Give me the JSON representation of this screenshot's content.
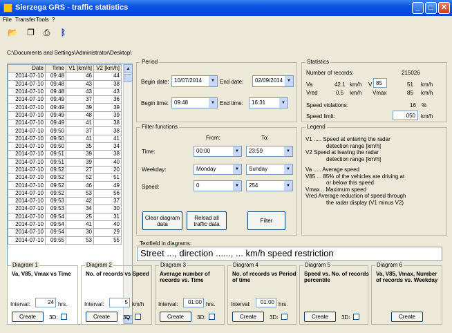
{
  "window": {
    "title": "Sierzega GRS - traffic statistics"
  },
  "menu": [
    "File",
    "Transfer",
    "Tools",
    "?"
  ],
  "path": "C:\\Documents and Settings\\Administrator\\Desktop\\",
  "table": {
    "headers": [
      "Date",
      "Time",
      "V1 [km/h]",
      "V2 [km/h]"
    ],
    "rows": [
      [
        "2014-07-10",
        "09:48",
        "46",
        "44"
      ],
      [
        "2014-07-10",
        "09:48",
        "43",
        "38"
      ],
      [
        "2014-07-10",
        "09:48",
        "43",
        "43"
      ],
      [
        "2014-07-10",
        "09:49",
        "37",
        "36"
      ],
      [
        "2014-07-10",
        "09:49",
        "39",
        "39"
      ],
      [
        "2014-07-10",
        "09:49",
        "48",
        "39"
      ],
      [
        "2014-07-10",
        "09:49",
        "41",
        "38"
      ],
      [
        "2014-07-10",
        "09:50",
        "37",
        "38"
      ],
      [
        "2014-07-10",
        "09:50",
        "41",
        "41"
      ],
      [
        "2014-07-10",
        "09:50",
        "35",
        "34"
      ],
      [
        "2014-07-10",
        "09:51",
        "39",
        "38"
      ],
      [
        "2014-07-10",
        "09:51",
        "39",
        "40"
      ],
      [
        "2014-07-10",
        "09:52",
        "27",
        "20"
      ],
      [
        "2014-07-10",
        "09:52",
        "52",
        "51"
      ],
      [
        "2014-07-10",
        "09:52",
        "46",
        "49"
      ],
      [
        "2014-07-10",
        "09:52",
        "53",
        "56"
      ],
      [
        "2014-07-10",
        "09:53",
        "42",
        "37"
      ],
      [
        "2014-07-10",
        "09:53",
        "34",
        "30"
      ],
      [
        "2014-07-10",
        "09:54",
        "25",
        "31"
      ],
      [
        "2014-07-10",
        "09:54",
        "41",
        "40"
      ],
      [
        "2014-07-10",
        "09:54",
        "30",
        "29"
      ],
      [
        "2014-07-10",
        "09:55",
        "53",
        "55"
      ]
    ]
  },
  "period": {
    "label": "Period",
    "begin_date_label": "Begin date:",
    "begin_date": "10/07/2014",
    "end_date_label": "End date:",
    "end_date": "02/09/2014",
    "begin_time_label": "Begin time:",
    "begin_time": "09:48",
    "end_time_label": "End time:",
    "end_time": "16:31"
  },
  "statistics": {
    "label": "Statistics",
    "records_label": "Number of records:",
    "records": "215026",
    "va_label": "Va",
    "va": "42.1",
    "va_unit": "km/h",
    "v_label": "V",
    "v_pct": "85",
    "v_val": "51",
    "v_unit": "km/h",
    "vred_label": "Vred",
    "vred": "0.5",
    "vred_unit": "km/h",
    "vmax_label": "Vmax",
    "vmax": "85",
    "vmax_unit": "km/h",
    "violations_label": "Speed violations:",
    "violations": "16",
    "violations_unit": "%",
    "limit_label": "Speed limit:",
    "limit": "050",
    "limit_unit": "km/h"
  },
  "filter": {
    "label": "Filter functions",
    "from_label": "From:",
    "to_label": "To:",
    "time_label": "Time:",
    "time_from": "00:00",
    "time_to": "23:59",
    "weekday_label": "Weekday:",
    "weekday_from": "Monday",
    "weekday_to": "Sunday",
    "speed_label": "Speed:",
    "speed_from": "0",
    "speed_to": "254",
    "clear_btn": "Clear diagram data",
    "reload_btn": "Reload all traffic data",
    "filter_btn": "Filter"
  },
  "legend": {
    "label": "Legend",
    "lines": [
      "V1 ..... Speed at entering the radar",
      "             detection range [km/h]",
      "V2      Speed at leaving the radar",
      "             detection range [km/h]",
      "",
      "Va ..... Average speed",
      "V85 ... 85% of the vehicles are driving at",
      "             or below this speed",
      "Vmax .. Maximum speed",
      "Vred    Average reduction of speed through",
      "             the radar display (V1 minus V2)"
    ]
  },
  "textfield": {
    "label": "Textfield in diagrams:",
    "value": "Street ..., direction ......, ... km/h speed restriction"
  },
  "diagrams": [
    {
      "label": "Diagram 1",
      "title": "Va, V85, Vmax vs Time",
      "interval_label": "Interval:",
      "interval": "24",
      "unit": "hrs.",
      "create": "Create",
      "three_d": "3D:"
    },
    {
      "label": "Diagram 2",
      "title": "No. of records vs Speed",
      "interval_label": "Interval:",
      "interval": "5",
      "unit": "km/h",
      "create": "Create",
      "three_d": "3D:"
    },
    {
      "label": "Diagram 3",
      "title": "Average number of records vs. Time",
      "interval_label": "Interval:",
      "interval": "01:00",
      "unit": "hrs.",
      "create": "Create",
      "three_d": "3D:"
    },
    {
      "label": "Diagram 4",
      "title": "No. of records vs Period of time",
      "interval_label": "Interval:",
      "interval": "01:00",
      "unit": "hrs.",
      "create": "Create",
      "three_d": "3D:"
    },
    {
      "label": "Diagram 5",
      "title": "Speed vs. No. of records percentile",
      "create": "Create",
      "three_d": "3D:"
    },
    {
      "label": "Diagram 6",
      "title": "Va, V85, Vmax, Number of records vs. Weekday",
      "create": "Create"
    }
  ]
}
